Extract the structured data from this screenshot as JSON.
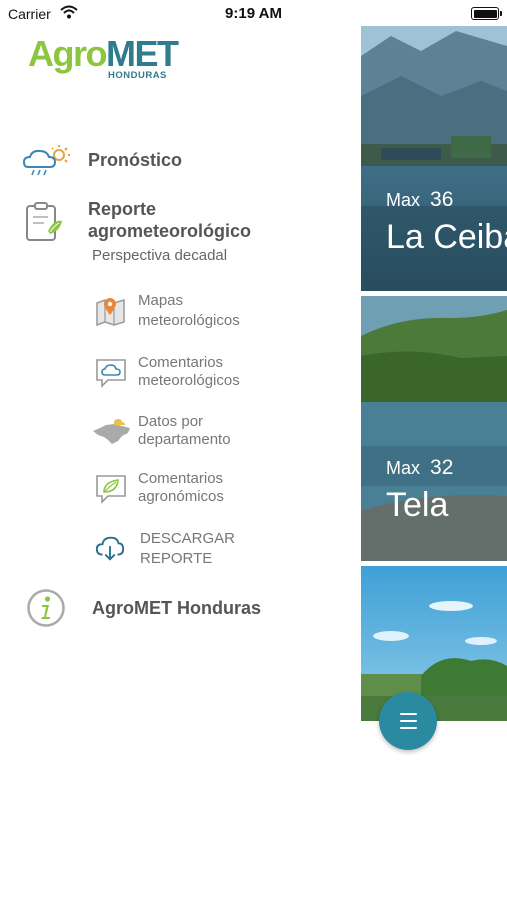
{
  "status_bar": {
    "carrier": "Carrier",
    "time": "9:19 AM"
  },
  "logo": {
    "agro": "Agro",
    "met": "MET",
    "subtitle": "HONDURAS"
  },
  "menu": {
    "pronostico": "Pronóstico",
    "reporte_line1": "Reporte",
    "reporte_line2": "agrometeorológico",
    "reporte_desc": "Perspectiva decadal",
    "subitems": [
      {
        "line1": "Mapas",
        "line2": "meteorológicos",
        "icon": "map-pin-icon"
      },
      {
        "line1": "Comentarios",
        "line2": "meteorológicos",
        "icon": "cloud-chat-icon"
      },
      {
        "line1": "Datos por",
        "line2": "departamento",
        "icon": "country-map-icon"
      },
      {
        "line1": "Comentarios",
        "line2": "agronómicos",
        "icon": "leaf-chat-icon"
      },
      {
        "line1": "DESCARGAR",
        "line2": "REPORTE",
        "icon": "cloud-download-icon"
      }
    ],
    "about": "AgroMET Honduras"
  },
  "cards": [
    {
      "max_label": "Max",
      "max_value": "36",
      "city": "La Ceiba"
    },
    {
      "max_label": "Max",
      "max_value": "32",
      "city": "Tela"
    },
    {
      "max_label": "",
      "max_value": "",
      "city": ""
    }
  ],
  "colors": {
    "brand_green": "#8cc63f",
    "brand_teal": "#2d7d8c",
    "fab": "#2a8aa0"
  }
}
